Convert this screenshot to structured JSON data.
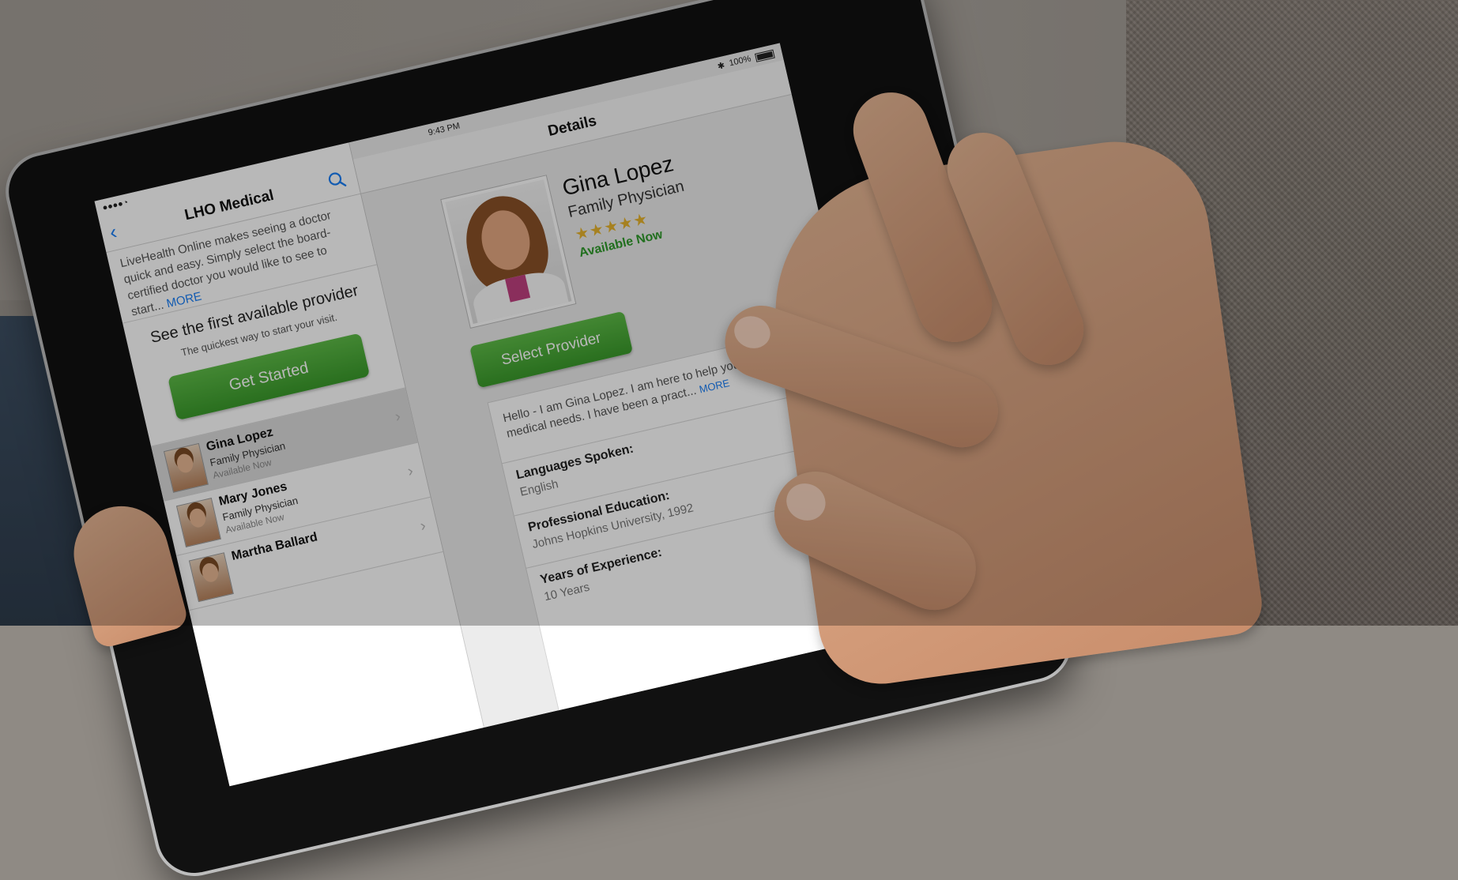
{
  "status_bar": {
    "signal": "●●●● ",
    "time": "9:43 PM",
    "battery": "100%"
  },
  "master": {
    "title": "LHO Medical",
    "back_icon": "chevron-left-icon",
    "search_icon": "search-icon",
    "intro_text": "LiveHealth Online makes seeing a doctor quick and easy. Simply select the board-certified doctor you would like to see to start...",
    "intro_more": "MORE",
    "first_available_heading": "See the first available provider",
    "first_available_sub": "The quickest way to start your visit.",
    "get_started_label": "Get Started",
    "providers": [
      {
        "name": "Gina Lopez",
        "title": "Family Physician",
        "status": "Available Now"
      },
      {
        "name": "Mary Jones",
        "title": "Family Physician",
        "status": "Available Now"
      },
      {
        "name": "Martha Ballard",
        "title": "",
        "status": ""
      }
    ]
  },
  "detail": {
    "title": "Details",
    "name": "Gina Lopez",
    "specialty": "Family Physician",
    "stars": "★★★★★",
    "rating": 5,
    "availability": "Available Now",
    "select_label": "Select Provider",
    "bio": "Hello - I am Gina Lopez. I am here to help you with your medical needs. I have been a pract...",
    "bio_more": "MORE",
    "languages_label": "Languages Spoken:",
    "languages_value": "English",
    "education_label": "Professional Education:",
    "education_value": "Johns Hopkins University, 1992",
    "experience_label": "Years of Experience:",
    "experience_value": "10 Years"
  },
  "colors": {
    "accent_blue": "#1a7ef5",
    "button_green": "#3a9a2b",
    "available_green": "#2f9a2a",
    "star_gold": "#e6b32d"
  }
}
